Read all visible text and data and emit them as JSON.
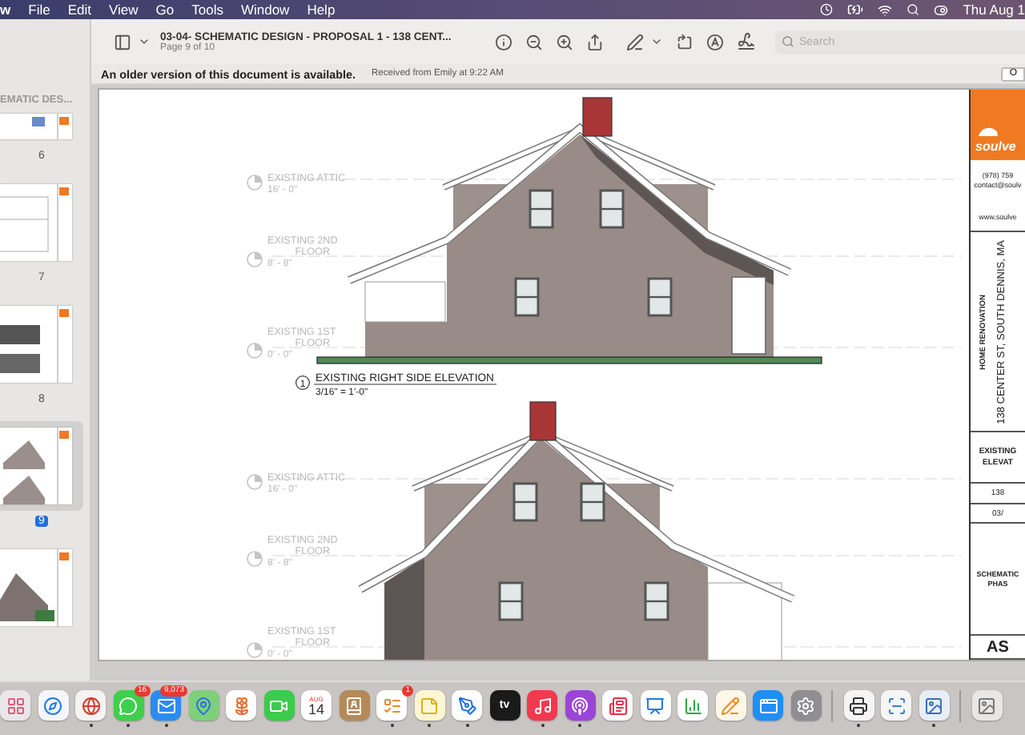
{
  "menu_bar": {
    "app": "w",
    "items": [
      "File",
      "Edit",
      "View",
      "Go",
      "Tools",
      "Window",
      "Help"
    ],
    "clock": "Thu Aug 1"
  },
  "toolbar": {
    "title": "03-04- SCHEMATIC DESIGN - PROPOSAL 1 - 138 CENT...",
    "subtitle": "Page 9 of 10",
    "search": {
      "placeholder": "Search"
    }
  },
  "notice": {
    "message": "An older version of this document is available.",
    "detail": "Received from Emily at 9:22 AM",
    "button": "O"
  },
  "sidebar": {
    "heading": "EMATIC DES...",
    "pages": [
      {
        "label": "6",
        "selected": false,
        "kind": "sheet"
      },
      {
        "label": "7",
        "selected": false,
        "kind": "plan"
      },
      {
        "label": "8",
        "selected": false,
        "kind": "dark-house"
      },
      {
        "label": "9",
        "selected": true,
        "kind": "gray-house"
      },
      {
        "selected": false,
        "kind": "model"
      }
    ]
  },
  "sheet": {
    "elevations": [
      {
        "levels": [
          {
            "name_lines": [
              "EXISTING ATTIC"
            ],
            "elevation": "16' - 0\""
          },
          {
            "name_lines": [
              "EXISTING 2ND",
              "FLOOR"
            ],
            "elevation": "8' - 8\""
          },
          {
            "name_lines": [
              "EXISTING 1ST",
              "FLOOR"
            ],
            "elevation": "0' - 0\""
          }
        ],
        "caption": {
          "number": "1",
          "title": "EXISTING RIGHT SIDE ELEVATION",
          "scale": "3/16\" = 1'-0\""
        }
      },
      {
        "levels": [
          {
            "name_lines": [
              "EXISTING ATTIC"
            ],
            "elevation": "16' - 0\""
          },
          {
            "name_lines": [
              "EXISTING 2ND",
              "FLOOR"
            ],
            "elevation": "8' - 8\""
          },
          {
            "name_lines": [
              "EXISTING 1ST",
              "FLOOR"
            ],
            "elevation": "0' - 0\""
          }
        ]
      }
    ],
    "title_block": {
      "brand": "soulve",
      "phone": "(978) 759",
      "email": "contact@soulv",
      "website": "www.soulve",
      "project": "HOME RENOVATION",
      "address": "138 CENTER ST, SOUTH DENNIS, MA",
      "sheet_title": [
        "EXISTING",
        "ELEVAT"
      ],
      "number": "138",
      "date": "03/",
      "phase": [
        "SCHEMATIC",
        "PHAS"
      ],
      "sheet_number": "AS"
    }
  },
  "dock": {
    "items": [
      {
        "kind": "grid",
        "running": false
      },
      {
        "kind": "compass",
        "running": false
      },
      {
        "kind": "browser",
        "running": true
      },
      {
        "kind": "chat",
        "running": true,
        "badge": "16"
      },
      {
        "kind": "mail",
        "running": true,
        "badge": "9,073"
      },
      {
        "kind": "map",
        "running": false
      },
      {
        "kind": "photos",
        "running": false
      },
      {
        "kind": "video",
        "running": false
      },
      {
        "kind": "calendar",
        "running": false,
        "month": "AUG",
        "day": "14"
      },
      {
        "kind": "contacts",
        "running": false
      },
      {
        "kind": "list",
        "running": true,
        "badge": "1"
      },
      {
        "kind": "notes",
        "running": true
      },
      {
        "kind": "freeform",
        "running": true
      },
      {
        "kind": "tv",
        "running": false,
        "label": "tv"
      },
      {
        "kind": "music",
        "running": true
      },
      {
        "kind": "podcast",
        "running": true
      },
      {
        "kind": "news",
        "running": false
      },
      {
        "kind": "keynote",
        "running": false
      },
      {
        "kind": "chart",
        "running": false
      },
      {
        "kind": "pages",
        "running": false
      },
      {
        "kind": "store",
        "running": false
      },
      {
        "kind": "gear",
        "running": false
      },
      {
        "kind": "separator"
      },
      {
        "kind": "printer",
        "running": true
      },
      {
        "kind": "scanner",
        "running": false
      },
      {
        "kind": "preview",
        "running": true
      },
      {
        "kind": "separator"
      },
      {
        "kind": "image",
        "running": false
      }
    ]
  }
}
